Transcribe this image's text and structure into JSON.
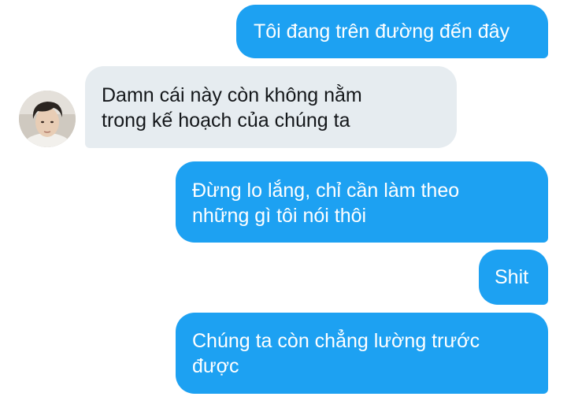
{
  "conversation": {
    "messages": [
      {
        "sender": "me",
        "text": "Tôi đang trên đường đến đây"
      },
      {
        "sender": "them",
        "text": "Damn cái này còn không nằm\ntrong kế hoạch của chúng ta"
      },
      {
        "sender": "me",
        "text": "Đừng lo lắng, chỉ cần làm theo\nnhững gì tôi nói thôi"
      },
      {
        "sender": "me",
        "text": "Shit"
      },
      {
        "sender": "me",
        "text": "Chúng ta còn chẳng lường trước\nđược"
      }
    ]
  },
  "colors": {
    "sent_bubble": "#1da1f2",
    "received_bubble": "#e6ecf0",
    "received_text": "#14171a"
  }
}
